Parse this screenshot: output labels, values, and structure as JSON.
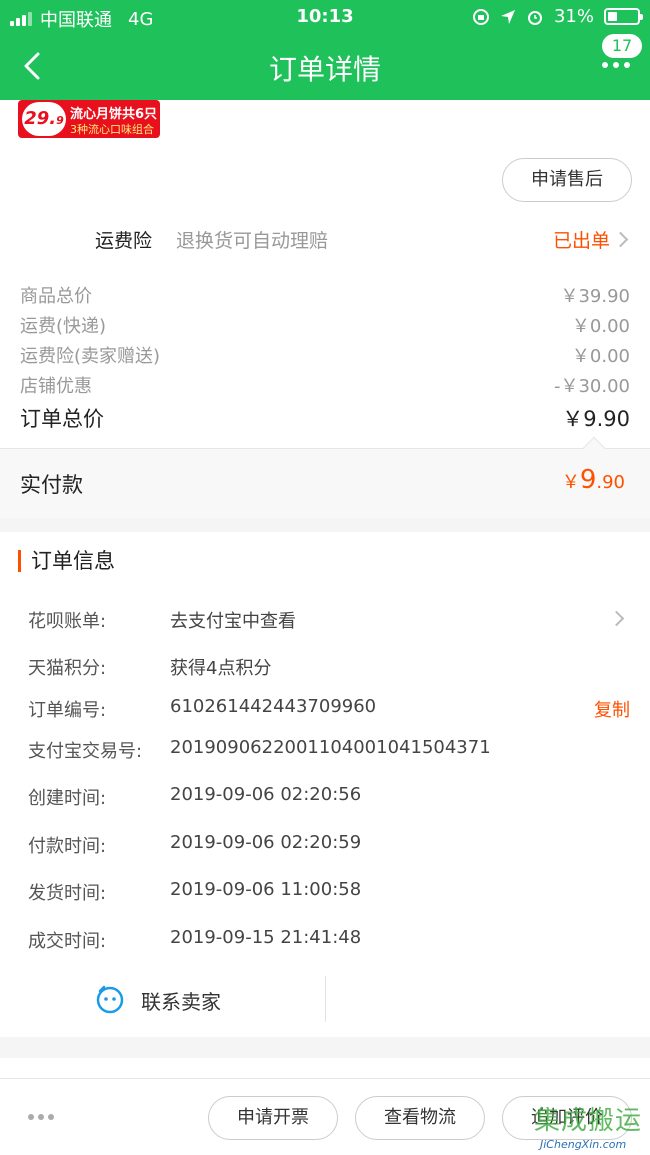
{
  "status_bar": {
    "carrier": "中国联通",
    "network": "4G",
    "time": "10:13",
    "battery": "31%",
    "battery_level": 0.31
  },
  "nav": {
    "title": "订单详情",
    "badge": "17"
  },
  "promo": {
    "price": "29.",
    "price_cents": "9",
    "line1": "流心月饼共6只",
    "line2": "3种流心口味组合"
  },
  "after_sale_button": "申请售后",
  "insurance": {
    "name": "运费险",
    "desc": "退换货可自动理赔",
    "status": "已出单"
  },
  "prices": [
    {
      "label": "商品总价",
      "value": "￥39.90"
    },
    {
      "label": "运费(快递)",
      "value": "￥0.00"
    },
    {
      "label": "运费险(卖家赠送)",
      "value": "￥0.00"
    },
    {
      "label": "店铺优惠",
      "value": "-￥30.00"
    }
  ],
  "order_total": {
    "label": "订单总价",
    "value": "￥9.90"
  },
  "paid": {
    "label": "实付款",
    "currency": "￥",
    "int": "9",
    "dec": ".90"
  },
  "order_info": {
    "title": "订单信息",
    "rows": [
      {
        "key": "花呗账单:",
        "value": "去支付宝中查看"
      },
      {
        "key": "天猫积分:",
        "value": "获得4点积分"
      },
      {
        "key": "订单编号:",
        "value": "610261442443709960",
        "action": "复制"
      },
      {
        "key": "支付宝交易号:",
        "value": "2019090622001104001041504371"
      },
      {
        "key": "创建时间:",
        "value": "2019-09-06 02:20:56"
      },
      {
        "key": "付款时间:",
        "value": "2019-09-06 02:20:59"
      },
      {
        "key": "发货时间:",
        "value": "2019-09-06 11:00:58"
      },
      {
        "key": "成交时间:",
        "value": "2019-09-15 21:41:48"
      }
    ]
  },
  "contact": {
    "label": "联系卖家"
  },
  "bottom": {
    "invoice": "申请开票",
    "logistics": "查看物流",
    "review": "追加评价"
  },
  "watermark": {
    "cn": "集成搬运",
    "en": "JiChengXin.com"
  },
  "colors": {
    "brand_green": "#1ec15a",
    "accent_orange": "#ff5000",
    "contact_blue": "#1a9be8"
  }
}
